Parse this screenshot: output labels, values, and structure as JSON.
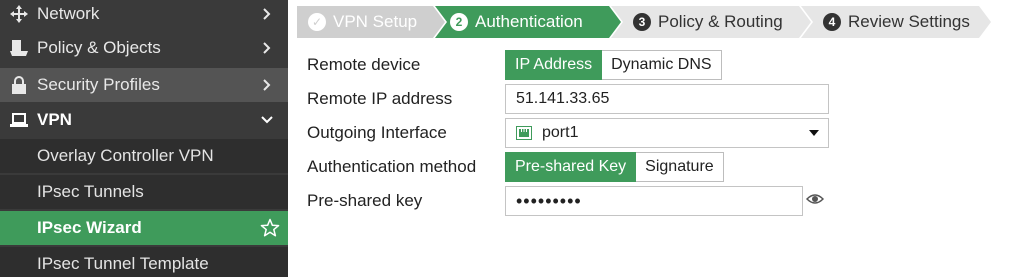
{
  "sidebar": {
    "items": [
      {
        "label": "Network",
        "icon": "network-arrows-icon"
      },
      {
        "label": "Policy & Objects",
        "icon": "policy-icon"
      },
      {
        "label": "Security Profiles",
        "icon": "lock-icon"
      },
      {
        "label": "VPN",
        "icon": "laptop-icon"
      }
    ],
    "vpn_subitems": [
      {
        "label": "Overlay Controller VPN"
      },
      {
        "label": "IPsec Tunnels"
      },
      {
        "label": "IPsec Wizard"
      },
      {
        "label": "IPsec Tunnel Template"
      }
    ]
  },
  "wizard": {
    "steps": [
      {
        "label": "VPN Setup",
        "marker": "✓",
        "state": "done"
      },
      {
        "label": "Authentication",
        "marker": "2",
        "state": "active"
      },
      {
        "label": "Policy & Routing",
        "marker": "3",
        "state": "todo"
      },
      {
        "label": "Review Settings",
        "marker": "4",
        "state": "todo"
      }
    ]
  },
  "form": {
    "remote_device": {
      "label": "Remote device",
      "options": [
        "IP Address",
        "Dynamic DNS"
      ],
      "selected": "IP Address"
    },
    "remote_ip": {
      "label": "Remote IP address",
      "value": "51.141.33.65"
    },
    "outgoing_interface": {
      "label": "Outgoing Interface",
      "value": "port1"
    },
    "auth_method": {
      "label": "Authentication method",
      "options": [
        "Pre-shared Key",
        "Signature"
      ],
      "selected": "Pre-shared Key"
    },
    "psk": {
      "label": "Pre-shared key",
      "value": "•••••••••"
    }
  },
  "colors": {
    "accent": "#3f9b5b",
    "sidebar_bg": "#3a3a3a",
    "step_done": "#cfcfcf",
    "step_todo": "#e6e6e6"
  }
}
